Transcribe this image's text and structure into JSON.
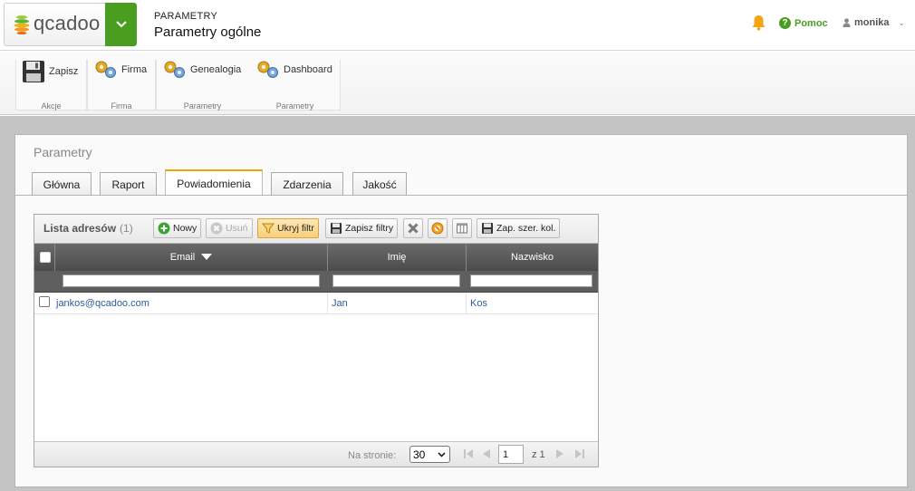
{
  "app": {
    "logo_text": "qcadoo",
    "breadcrumb_top": "PARAMETRY",
    "breadcrumb_title": "Parametry ogólne",
    "help_label": "Pomoc",
    "user_name": "monika"
  },
  "ribbon": {
    "groups": [
      {
        "label": "Akcje",
        "button": "Zapisz",
        "icon": "save-icon"
      },
      {
        "label": "Firma",
        "button": "Firma",
        "icon": "gears-icon"
      },
      {
        "label": "Parametry",
        "button": "Genealogia",
        "icon": "gears-icon"
      },
      {
        "label": "Parametry",
        "button": "Dashboard",
        "icon": "gears-icon"
      }
    ]
  },
  "panel": {
    "title": "Parametry",
    "tabs": [
      {
        "label": "Główna",
        "active": false
      },
      {
        "label": "Raport",
        "active": false
      },
      {
        "label": "Powiadomienia",
        "active": true
      },
      {
        "label": "Zdarzenia",
        "active": false
      },
      {
        "label": "Jakość",
        "active": false
      }
    ]
  },
  "grid": {
    "title": "Lista adresów",
    "count": "(1)",
    "toolbar": {
      "new": "Nowy",
      "delete": "Usuń",
      "hide_filter": "Ukryj filtr",
      "save_filters": "Zapisz filtry",
      "save_widths": "Zap. szer. kol."
    },
    "columns": [
      {
        "label": "Email",
        "sorted": "desc"
      },
      {
        "label": "Imię"
      },
      {
        "label": "Nazwisko"
      }
    ],
    "rows": [
      {
        "email": "jankos@qcadoo.com",
        "first_name": "Jan",
        "last_name": "Kos"
      }
    ],
    "footer": {
      "per_page_label": "Na stronie:",
      "per_page_value": "30",
      "current_page": "1",
      "of_pages": "z 1"
    }
  },
  "colors": {
    "brand_green": "#4a9e1f",
    "tab_accent": "#f0a500",
    "link_blue": "#2b5e9a",
    "header_dark": "#4b4b4b"
  }
}
